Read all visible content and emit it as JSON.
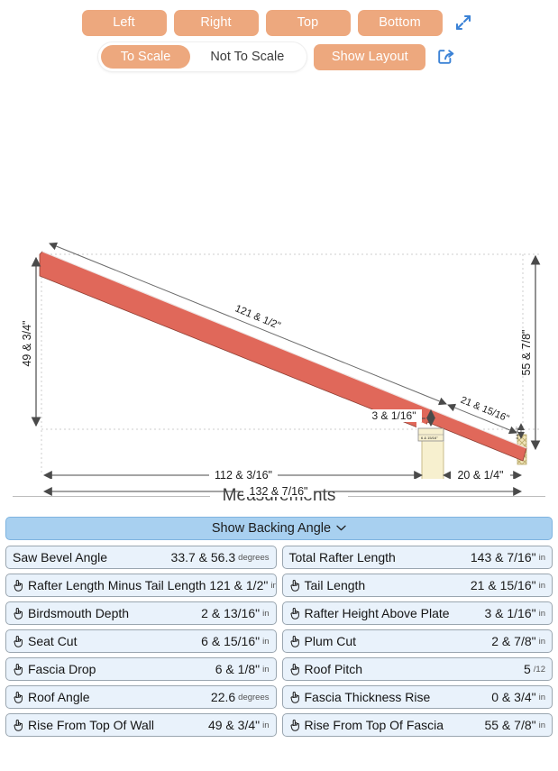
{
  "toolbar": {
    "views": [
      {
        "label": "Left",
        "name": "view-left"
      },
      {
        "label": "Right",
        "name": "view-right"
      },
      {
        "label": "Top",
        "name": "view-top"
      },
      {
        "label": "Bottom",
        "name": "view-bottom"
      }
    ],
    "scale_toggle": {
      "to_scale": "To Scale",
      "not_to_scale": "Not To Scale",
      "selected": "To Scale"
    },
    "show_layout": "Show Layout",
    "expand_icon": "expand-arrows-icon",
    "share_icon": "share-icon",
    "accent_color": "#eda87e",
    "icon_color": "#3b82d6"
  },
  "diagram": {
    "type": "rafter-elevation",
    "rafter_color": "#e0685a",
    "wall_color": "#f7f0cf",
    "fascia_color": "#f0e4b8",
    "labels": {
      "rafter_run_length": "121 & 1/2\"",
      "tail_length": "21 & 15/16\"",
      "rise_from_top_of_wall": "49 & 3/4\"",
      "rise_from_top_of_fascia": "55 & 7/8\"",
      "rafter_height_above_plate": "3 & 1/16\"",
      "horizontal_run": "112 & 3/16\"",
      "total_horizontal": "132 & 7/16\"",
      "overhang_run": "20 & 1/4\"",
      "seat_cut": "6 & 15/16\"",
      "fascia_thickness": "0 & 3/4\""
    }
  },
  "measurements": {
    "section_label": "Measurements",
    "backing_angle_button": "Show Backing Angle",
    "chevron": "⌄",
    "rows": [
      {
        "left": {
          "label": "Saw Bevel Angle",
          "value": "33.7 & 56.3",
          "unit": "degrees",
          "hand": false
        },
        "right": {
          "label": "Total Rafter Length",
          "value": "143 & 7/16\"",
          "unit": "in",
          "hand": false
        }
      },
      {
        "left": {
          "label": "Rafter Length Minus Tail Length",
          "value": "121 & 1/2\"",
          "unit": "in",
          "hand": true
        },
        "right": {
          "label": "Tail Length",
          "value": "21 & 15/16\"",
          "unit": "in",
          "hand": true
        }
      },
      {
        "left": {
          "label": "Birdsmouth Depth",
          "value": "2 & 13/16\"",
          "unit": "in",
          "hand": true
        },
        "right": {
          "label": "Rafter Height Above Plate",
          "value": "3 & 1/16\"",
          "unit": "in",
          "hand": true
        }
      },
      {
        "left": {
          "label": "Seat Cut",
          "value": "6 & 15/16\"",
          "unit": "in",
          "hand": true
        },
        "right": {
          "label": "Plum Cut",
          "value": "2 & 7/8\"",
          "unit": "in",
          "hand": true
        }
      },
      {
        "left": {
          "label": "Fascia Drop",
          "value": "6 & 1/8\"",
          "unit": "in",
          "hand": true
        },
        "right": {
          "label": "Roof Pitch",
          "value": "5",
          "unit": "/12",
          "hand": true
        }
      },
      {
        "left": {
          "label": "Roof Angle",
          "value": "22.6",
          "unit": "degrees",
          "hand": true
        },
        "right": {
          "label": "Fascia Thickness Rise",
          "value": "0 & 3/4\"",
          "unit": "in",
          "hand": true
        }
      },
      {
        "left": {
          "label": "Rise From Top Of Wall",
          "value": "49 & 3/4\"",
          "unit": "in",
          "hand": true
        },
        "right": {
          "label": "Rise From Top Of Fascia",
          "value": "55 & 7/8\"",
          "unit": "in",
          "hand": true
        }
      }
    ]
  }
}
